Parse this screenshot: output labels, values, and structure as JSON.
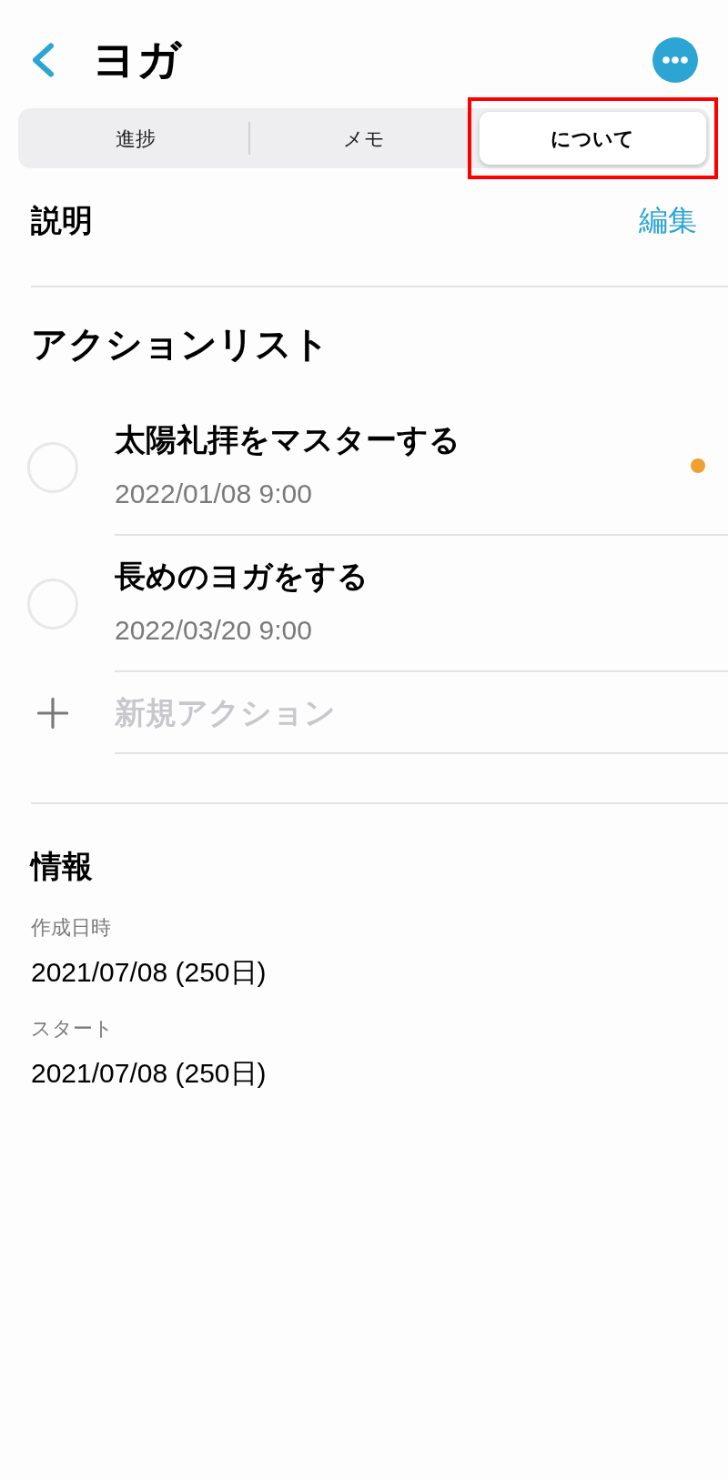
{
  "header": {
    "title": "ヨガ"
  },
  "tabs": [
    {
      "label": "進捗",
      "selected": false,
      "highlighted": false
    },
    {
      "label": "メモ",
      "selected": false,
      "highlighted": false
    },
    {
      "label": "について",
      "selected": true,
      "highlighted": true
    }
  ],
  "description": {
    "heading": "説明",
    "edit_link": "編集"
  },
  "action_list": {
    "heading": "アクションリスト",
    "items": [
      {
        "title": "太陽礼拝をマスターする",
        "date": "2022/01/08 9:00",
        "checked": false,
        "color": "#f0a030"
      },
      {
        "title": "長めのヨガをする",
        "date": "2022/03/20 9:00",
        "checked": false
      }
    ],
    "new_action": {
      "placeholder": "新規アクション"
    }
  },
  "info": {
    "heading": "情報",
    "fields": [
      {
        "label": "作成日時",
        "value": "2021/07/08 (250日)"
      },
      {
        "label": "スタート",
        "value": "2021/07/08 (250日)"
      }
    ]
  }
}
